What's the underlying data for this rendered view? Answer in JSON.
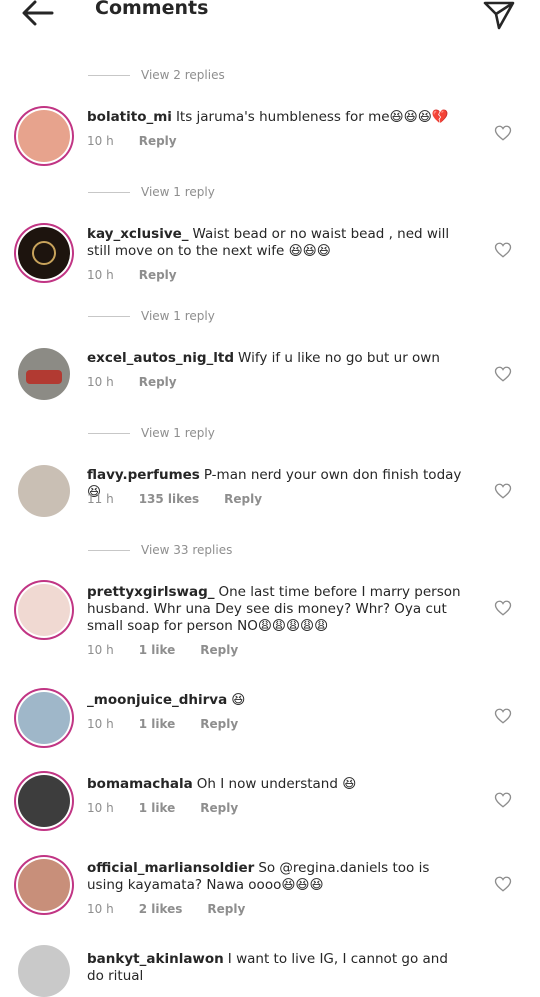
{
  "header": {
    "title": "Comments",
    "back_icon": "arrow-left-icon",
    "send_icon": "send-icon"
  },
  "view_replies": [
    "View 2 replies",
    "View 1 reply",
    "View 1 reply",
    "View 1 reply",
    "View 33 replies"
  ],
  "comments": [
    {
      "user": "bolatito_mi",
      "text": "Its jaruma's humbleness for me😆😆😆💔",
      "time": "10 h",
      "likes": "",
      "reply": "Reply",
      "avatar_color": "#e7a38d"
    },
    {
      "user": "kay_xclusive_",
      "text": "Waist bead or no waist bead , ned will still move on to the next wife 😆😆😆",
      "time": "10 h",
      "likes": "",
      "reply": "Reply",
      "avatar_color": "#1d140e"
    },
    {
      "user": "excel_autos_nig_ltd",
      "text": "Wify if u like no go but ur own",
      "time": "10 h",
      "likes": "",
      "reply": "Reply",
      "avatar_color": "#8c8b85"
    },
    {
      "user": "flavy.perfumes",
      "text": "P-man nerd your own don finish today😆",
      "time": "11 h",
      "likes": "135 likes",
      "reply": "Reply",
      "avatar_color": "#c9bfb4"
    },
    {
      "user": "prettyxgirlswag_",
      "text": "One last time before I marry person husband. Whr una Dey see dis money? Whr? Oya cut small soap for person NO😩😩😩😩😩",
      "time": "10 h",
      "likes": "1 like",
      "reply": "Reply",
      "avatar_color": "#f0d9d2"
    },
    {
      "user": "_moonjuice_dhirva",
      "text": "😆",
      "time": "10 h",
      "likes": "1 like",
      "reply": "Reply",
      "avatar_color": "#9fb7c9"
    },
    {
      "user": "bomamachala",
      "text": "Oh I now understand 😆",
      "time": "10 h",
      "likes": "1 like",
      "reply": "Reply",
      "avatar_color": "#3d3d3d"
    },
    {
      "user": "official_marliansoldier",
      "text": "So @regina.daniels too is using kayamata? Nawa oooo😆😆😆",
      "time": "10 h",
      "likes": "2 likes",
      "reply": "Reply",
      "avatar_color": "#c88f7a"
    },
    {
      "user": "bankyt_akinlawon",
      "text": "I want to live IG, I cannot go and do ritual",
      "time": "",
      "likes": "",
      "reply": "",
      "avatar_color": "#c9c9c9"
    }
  ]
}
